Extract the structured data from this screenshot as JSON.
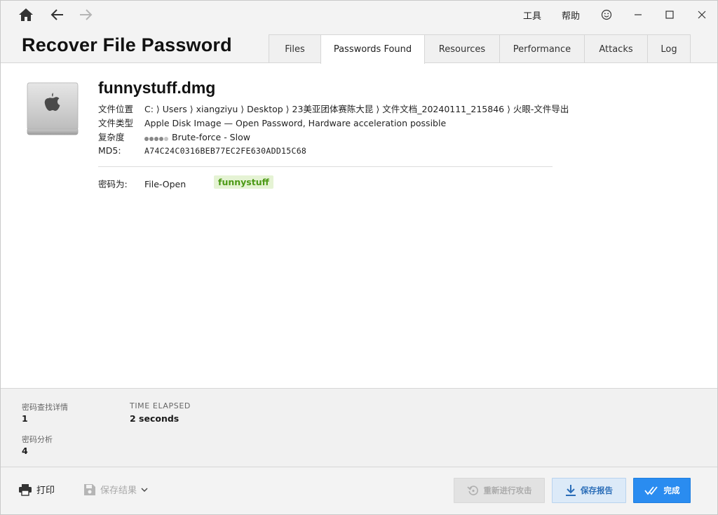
{
  "window": {
    "menu": {
      "tools": "工具",
      "help": "帮助"
    }
  },
  "app": {
    "title": "Recover File Password"
  },
  "tabs": [
    {
      "label": "Files"
    },
    {
      "label": "Passwords Found",
      "active": true
    },
    {
      "label": "Resources"
    },
    {
      "label": "Performance"
    },
    {
      "label": "Attacks"
    },
    {
      "label": "Log"
    }
  ],
  "file": {
    "name": "funnystuff.dmg",
    "location_label": "文件位置",
    "location_value": "C: ⟩ Users ⟩ xiangziyu ⟩ Desktop ⟩ 23美亚团体赛陈大昆 ⟩ 文件文档_20240111_215846 ⟩ 火眼-文件导出",
    "type_label": "文件类型",
    "type_value": "Apple Disk Image — Open Password, Hardware acceleration possible",
    "complexity_label": "复杂度",
    "complexity_value": "Brute-force - Slow",
    "complexity_level": 4,
    "complexity_max": 5,
    "md5_label": "MD5:",
    "md5_value": "A74C24C0316BEB77EC2FE630ADD15C68"
  },
  "password": {
    "label": "密码为:",
    "type": "File-Open",
    "value": "funnystuff"
  },
  "stats": {
    "found_label": "密码查找详情",
    "found_value": "1",
    "elapsed_label": "TIME ELAPSED",
    "elapsed_value": "2 seconds",
    "analyzed_label": "密码分析",
    "analyzed_value": "4"
  },
  "footer": {
    "print_label": "打印",
    "save_results_label": "保存结果",
    "retry_label": "重新进行攻击",
    "save_report_label": "保存报告",
    "done_label": "完成"
  },
  "colors": {
    "accent": "#2a8cf0",
    "password_badge_bg": "#e5f3d4",
    "password_badge_text": "#4c9a16"
  },
  "icons": {
    "home": "home-icon",
    "back": "arrow-left-icon",
    "forward": "arrow-right-icon",
    "feedback": "smiley-icon",
    "file": "disk-image-icon",
    "print": "printer-icon",
    "save": "floppy-icon",
    "retry": "retry-icon",
    "download": "download-icon",
    "done": "double-check-icon"
  }
}
